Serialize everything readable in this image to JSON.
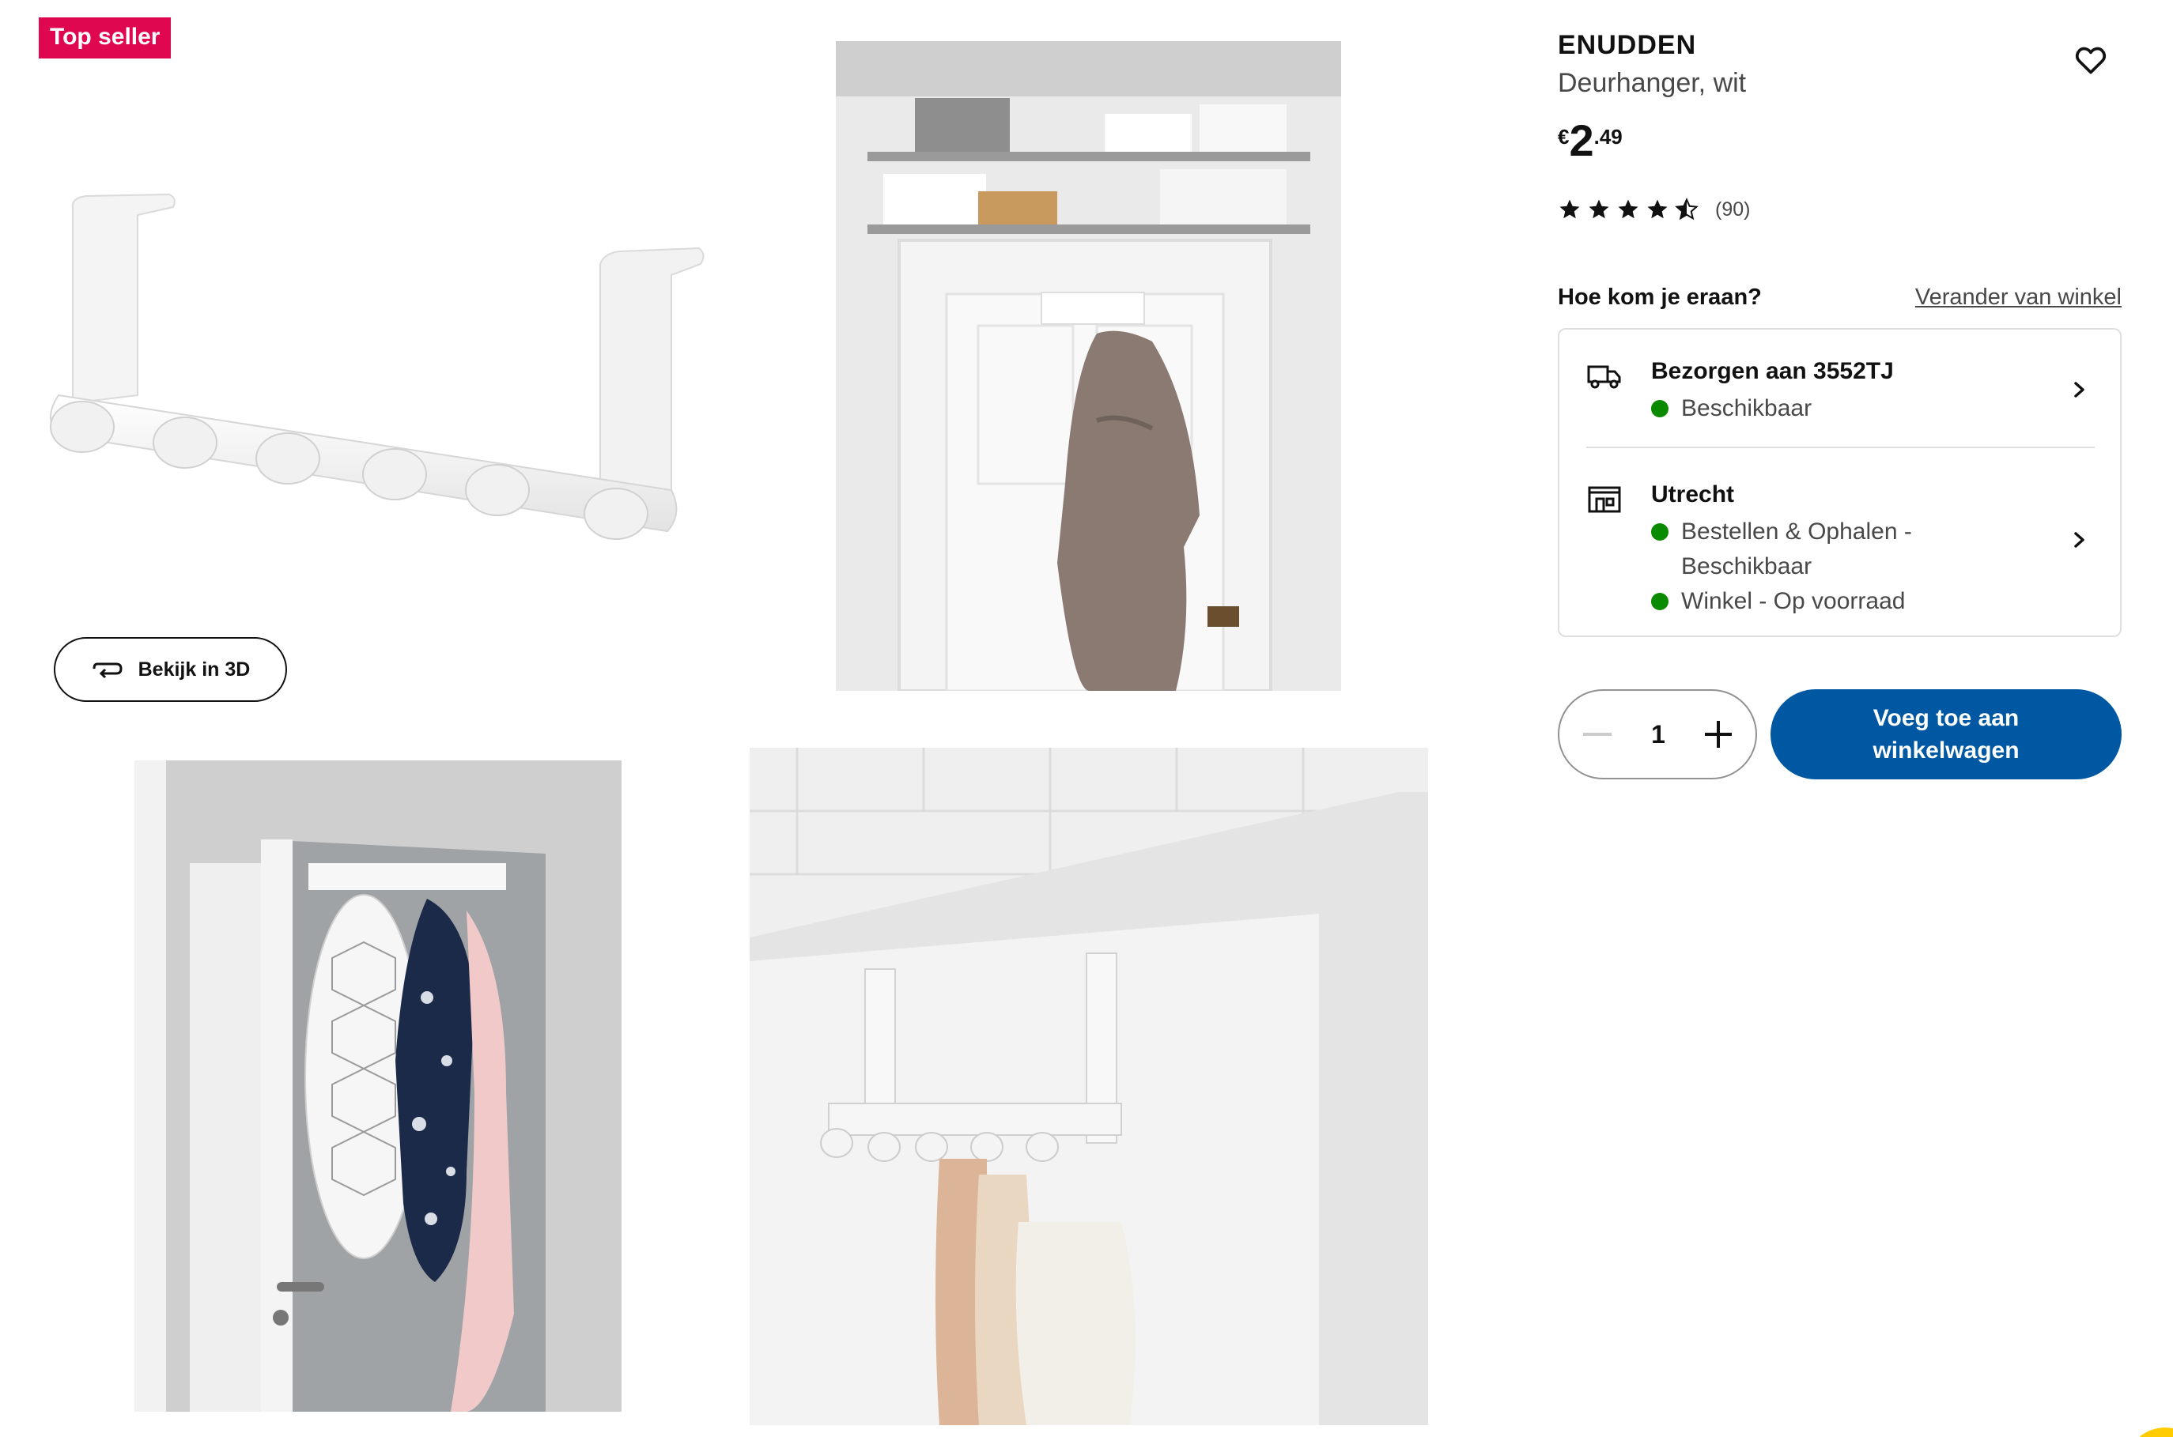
{
  "badge": {
    "label": "Top seller",
    "color": "#e00751"
  },
  "gallery": {
    "images": [
      {
        "name": "product-image-hanger"
      },
      {
        "name": "product-image-door-bathrobe"
      },
      {
        "name": "product-image-door-ironing-board"
      },
      {
        "name": "product-image-closeup-towels"
      }
    ],
    "view3d_label": "Bekijk in 3D"
  },
  "product": {
    "name": "ENUDDEN",
    "description": "Deurhanger, wit",
    "price": {
      "currency": "€",
      "integer": "2",
      "decimal": ".49"
    },
    "rating": {
      "stars": 4.5,
      "max": 5,
      "count": "(90)"
    }
  },
  "availability": {
    "heading": "Hoe kom je eraan?",
    "change_store": "Verander van winkel",
    "delivery": {
      "title": "Bezorgen aan 3552TJ",
      "status": "Beschikbaar"
    },
    "store": {
      "title": "Utrecht",
      "status_1": "Bestellen & Ophalen - Beschikbaar",
      "status_2": "Winkel - Op voorraad"
    },
    "status_color": "#0a8a00"
  },
  "cart": {
    "quantity": "1",
    "add_label": "Voeg toe aan winkelwagen",
    "accent": "#0058a3"
  }
}
